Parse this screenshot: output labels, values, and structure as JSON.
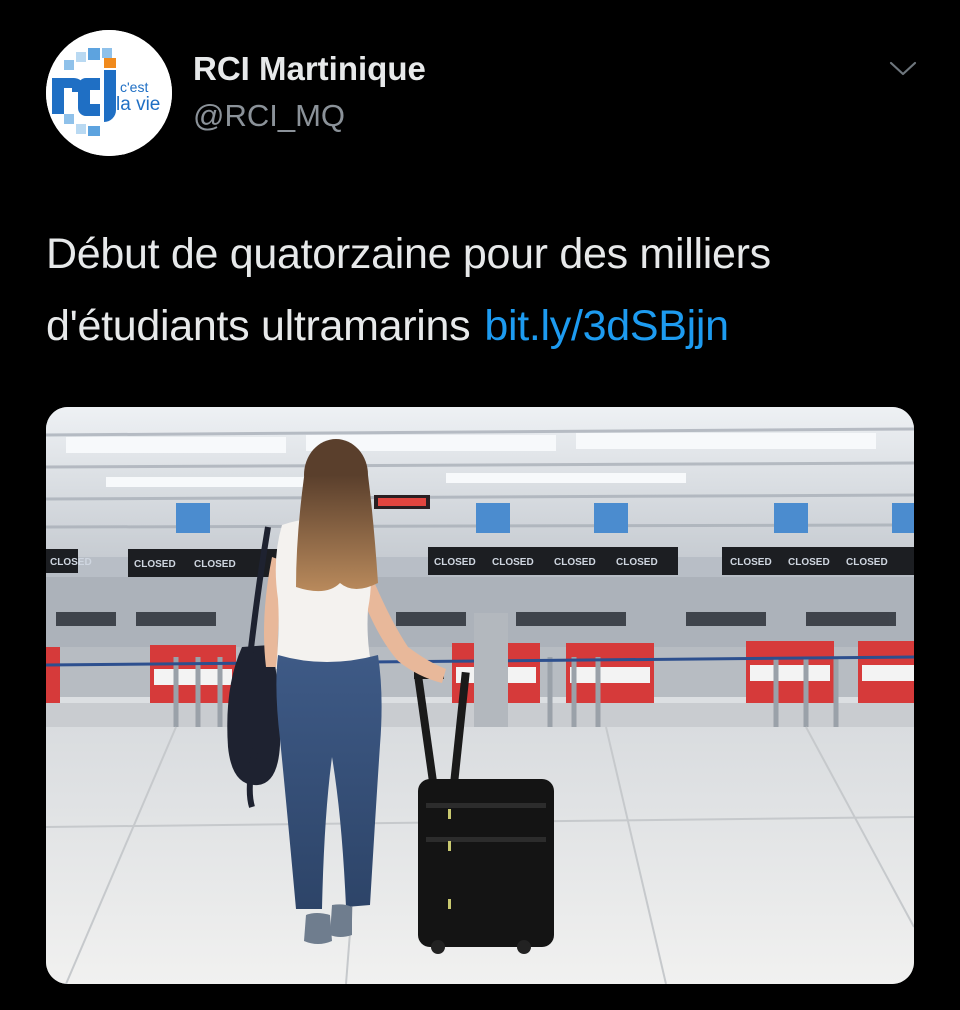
{
  "author": {
    "name": "RCI Martinique",
    "handle": "@RCI_MQ",
    "avatar_logo": {
      "tagline_line1": "c'est",
      "tagline_line2": "la vie",
      "icon": "rci-logo"
    }
  },
  "tweet": {
    "text": "Début de quatorzaine pour des milliers d'étudiants ultramarins",
    "link": "bit.ly/3dSBjjn"
  },
  "menu": {
    "icon": "chevron-down-icon"
  },
  "media": {
    "description_icon": "photo",
    "board_labels": [
      "CLOSED",
      "CLOSED",
      "CLOSED",
      "CLOSED",
      "CLOSED",
      "CLOSED",
      "CLOSED",
      "CLOSED",
      "CLOSED",
      "CLOSED"
    ]
  },
  "colors": {
    "background": "#000000",
    "text": "#e7e9ea",
    "secondary_text": "#8b9299",
    "link": "#1d9bf0",
    "logo_blue": "#1f6fc4",
    "logo_orange": "#f08a1c"
  }
}
